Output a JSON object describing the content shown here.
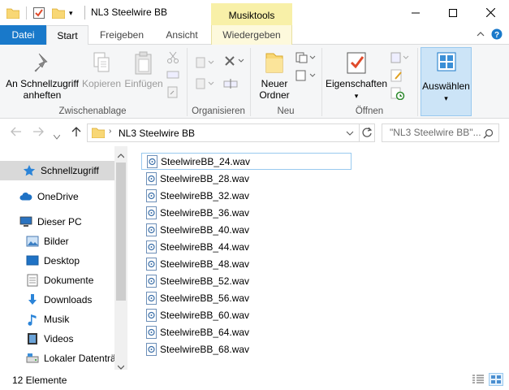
{
  "window": {
    "title": "NL3 Steelwire BB",
    "context_tab_group": "Musiktools"
  },
  "tabs": [
    {
      "label": "Datei"
    },
    {
      "label": "Start"
    },
    {
      "label": "Freigeben"
    },
    {
      "label": "Ansicht"
    },
    {
      "label": "Wiedergeben"
    }
  ],
  "ribbon": {
    "clipboard": {
      "group_label": "Zwischenablage",
      "pin_label_1": "An Schnellzugriff",
      "pin_label_2": "anheften",
      "copy_label": "Kopieren",
      "paste_label": "Einfügen"
    },
    "organize": {
      "group_label": "Organisieren"
    },
    "new": {
      "group_label": "Neu",
      "folder_label_1": "Neuer",
      "folder_label_2": "Ordner"
    },
    "open": {
      "group_label": "Öffnen",
      "properties_label": "Eigenschaften"
    },
    "select": {
      "label": "Auswählen"
    }
  },
  "address": {
    "path": "NL3 Steelwire BB",
    "search_placeholder": "\"NL3 Steelwire BB\"..."
  },
  "nav": {
    "items": [
      {
        "label": "Schnellzugriff",
        "icon": "star-icon"
      },
      {
        "label": "OneDrive",
        "icon": "cloud-icon"
      },
      {
        "label": "Dieser PC",
        "icon": "computer-icon"
      },
      {
        "label": "Bilder",
        "icon": "pictures-icon"
      },
      {
        "label": "Desktop",
        "icon": "desktop-icon"
      },
      {
        "label": "Dokumente",
        "icon": "documents-icon"
      },
      {
        "label": "Downloads",
        "icon": "download-icon"
      },
      {
        "label": "Musik",
        "icon": "music-icon"
      },
      {
        "label": "Videos",
        "icon": "videos-icon"
      },
      {
        "label": "Lokaler Datenträ",
        "icon": "drive-icon"
      }
    ]
  },
  "files": [
    {
      "name": "SteelwireBB_24.wav"
    },
    {
      "name": "SteelwireBB_28.wav"
    },
    {
      "name": "SteelwireBB_32.wav"
    },
    {
      "name": "SteelwireBB_36.wav"
    },
    {
      "name": "SteelwireBB_40.wav"
    },
    {
      "name": "SteelwireBB_44.wav"
    },
    {
      "name": "SteelwireBB_48.wav"
    },
    {
      "name": "SteelwireBB_52.wav"
    },
    {
      "name": "SteelwireBB_56.wav"
    },
    {
      "name": "SteelwireBB_60.wav"
    },
    {
      "name": "SteelwireBB_64.wav"
    },
    {
      "name": "SteelwireBB_68.wav"
    }
  ],
  "status": {
    "count": "12 Elemente"
  },
  "colors": {
    "accent": "#1979ca",
    "context_tab": "#f8f0a8",
    "folder": "#f8d775"
  }
}
